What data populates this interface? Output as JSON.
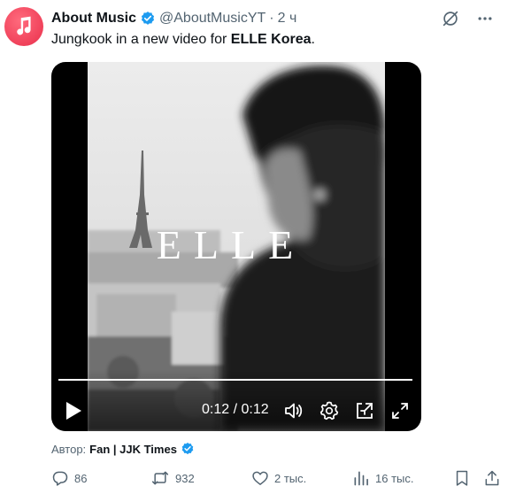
{
  "post": {
    "author_name": "About Music",
    "handle": "@AboutMusicYT",
    "separator": "·",
    "time": "2 ч",
    "text_before": "Jungkook in a new video for ",
    "text_bold": "ELLE Korea",
    "text_after": "."
  },
  "video": {
    "watermark": "ELLE",
    "current_time": "0:12",
    "time_separator": " / ",
    "duration": "0:12",
    "progress": 1.0
  },
  "credit": {
    "prefix": "Автор:",
    "user": "Fan | JJK Times"
  },
  "actions": {
    "replies": "86",
    "reposts": "932",
    "likes": "2 тыс.",
    "views": "16 тыс."
  },
  "colors": {
    "avatar": "#f0415a",
    "verified": "#1d9bf0",
    "muted_text": "#536471",
    "text": "#0f1419"
  },
  "icons": [
    "music-note-icon",
    "verified-badge-icon",
    "grok-icon",
    "more-icon",
    "play-icon",
    "volume-icon",
    "settings-icon",
    "pip-icon",
    "fullscreen-icon",
    "reply-icon",
    "repost-icon",
    "like-icon",
    "views-icon",
    "bookmark-icon",
    "share-icon"
  ]
}
